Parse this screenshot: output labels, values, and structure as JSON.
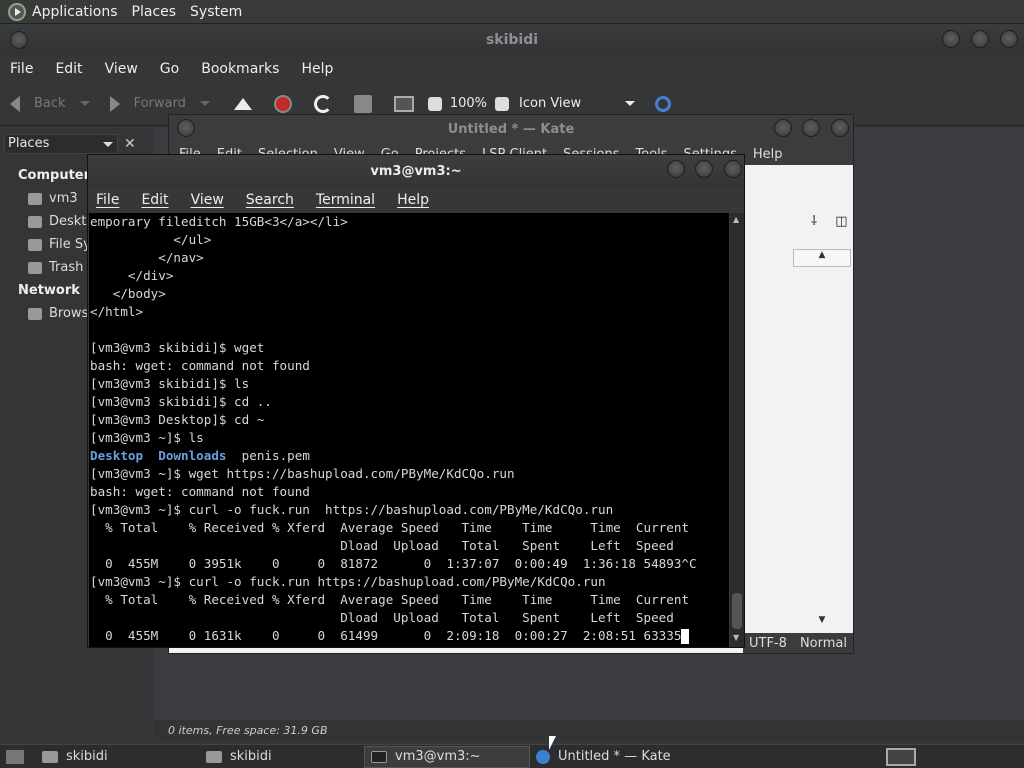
{
  "top_panel": {
    "items": [
      "Applications",
      "Places",
      "System"
    ]
  },
  "file_manager": {
    "title": "skibidi",
    "menu": [
      "File",
      "Edit",
      "View",
      "Go",
      "Bookmarks",
      "Help"
    ],
    "toolbar": {
      "back": "Back",
      "forward": "Forward",
      "zoom": "100%",
      "view_mode": "Icon View"
    },
    "sidebar": {
      "header": "Places",
      "sections": [
        {
          "title": "Computer",
          "items": [
            "vm3",
            "Deskt",
            "File Sy",
            "Trash"
          ]
        },
        {
          "title": "Network",
          "items": [
            "Brows"
          ]
        }
      ]
    },
    "status": "0 items, Free space: 31.9 GB"
  },
  "kate": {
    "title": "Untitled * — Kate",
    "menu": [
      "File",
      "Edit",
      "Selection",
      "View",
      "Go",
      "Projects",
      "LSP Client",
      "Sessions",
      "Tools",
      "Settings",
      "Help"
    ],
    "status": {
      "encoding": "UTF-8",
      "mode": "Normal"
    }
  },
  "terminal": {
    "title": "vm3@vm3:~",
    "menu": [
      "File",
      "Edit",
      "View",
      "Search",
      "Terminal",
      "Help"
    ],
    "lines": [
      "emporary fileditch 15GB<3</a></li>",
      "           </ul>",
      "         </nav>",
      "     </div>",
      "   </body>",
      "</html>",
      "",
      "[vm3@vm3 skibidi]$ wget",
      "bash: wget: command not found",
      "[vm3@vm3 skibidi]$ ls",
      "[vm3@vm3 skibidi]$ cd ..",
      "[vm3@vm3 Desktop]$ cd ~",
      "[vm3@vm3 ~]$ ls",
      "__LS__",
      "[vm3@vm3 ~]$ wget https://bashupload.com/PByMe/KdCQo.run",
      "bash: wget: command not found",
      "[vm3@vm3 ~]$ curl -o fuck.run  https://bashupload.com/PByMe/KdCQo.run",
      "  % Total    % Received % Xferd  Average Speed   Time    Time     Time  Current",
      "                                 Dload  Upload   Total   Spent    Left  Speed",
      "  0  455M    0 3951k    0     0  81872      0  1:37:07  0:00:49  1:36:18 54893^C",
      "[vm3@vm3 ~]$ curl -o fuck.run https://bashupload.com/PByMe/KdCQo.run",
      "  % Total    % Received % Xferd  Average Speed   Time    Time     Time  Current",
      "                                 Dload  Upload   Total   Spent    Left  Speed",
      "  0  455M    0 1631k    0     0  61499      0  2:09:18  0:00:27  2:08:51 63335"
    ],
    "ls_dirs": [
      "Desktop",
      "Downloads"
    ],
    "ls_file": "penis.pem"
  },
  "taskbar": {
    "tasks": [
      {
        "label": "skibidi",
        "active": false
      },
      {
        "label": "skibidi",
        "active": false
      },
      {
        "label": "vm3@vm3:~",
        "active": true
      },
      {
        "label": "Untitled * — Kate",
        "active": false
      }
    ]
  }
}
